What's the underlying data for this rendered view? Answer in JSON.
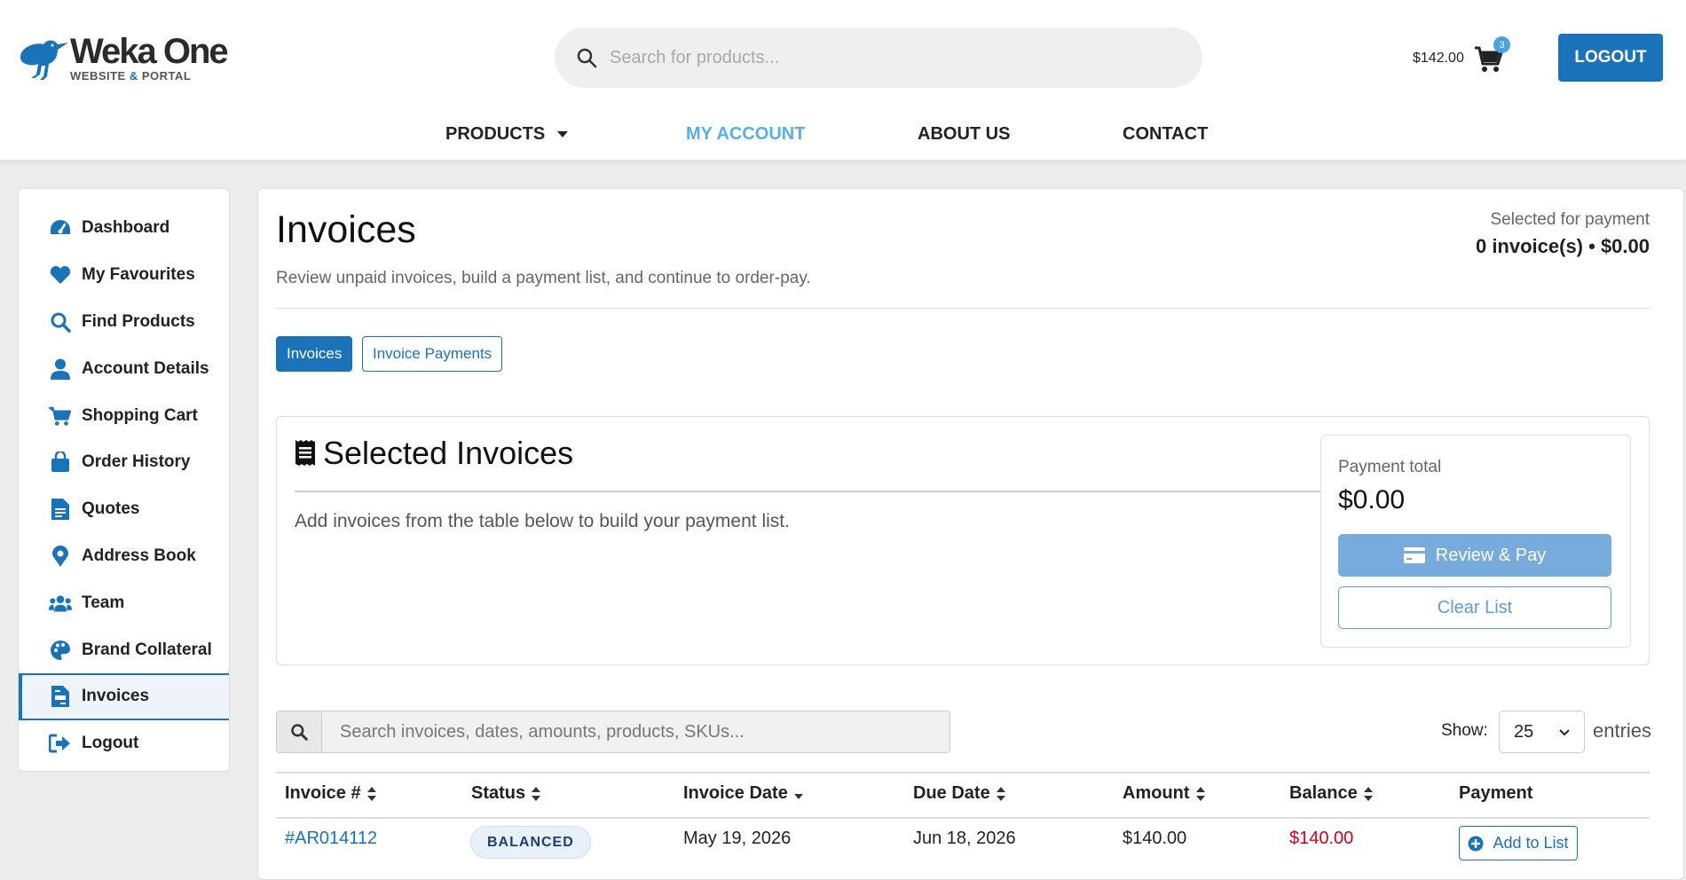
{
  "brand": {
    "name": "Weka One",
    "tagline_left": "WEBSITE",
    "tagline_amp": "&",
    "tagline_right": "PORTAL"
  },
  "search": {
    "placeholder": "Search for products..."
  },
  "cart": {
    "amount": "$142.00",
    "count": "3"
  },
  "header": {
    "logout_label": "LOGOUT"
  },
  "topnav": [
    {
      "label": "PRODUCTS",
      "active": false
    },
    {
      "label": "MY ACCOUNT",
      "active": true
    },
    {
      "label": "ABOUT US",
      "active": false
    },
    {
      "label": "CONTACT",
      "active": false
    }
  ],
  "sidebar": {
    "items": [
      {
        "label": "Dashboard",
        "icon": "dashboard-gauge-icon"
      },
      {
        "label": "My Favourites",
        "icon": "heart-icon"
      },
      {
        "label": "Find Products",
        "icon": "search-icon"
      },
      {
        "label": "Account Details",
        "icon": "user-icon"
      },
      {
        "label": "Shopping Cart",
        "icon": "cart-icon"
      },
      {
        "label": "Order History",
        "icon": "shopping-bag-icon"
      },
      {
        "label": "Quotes",
        "icon": "document-icon"
      },
      {
        "label": "Address Book",
        "icon": "map-pin-icon"
      },
      {
        "label": "Team",
        "icon": "team-icon"
      },
      {
        "label": "Brand Collateral",
        "icon": "palette-icon"
      },
      {
        "label": "Invoices",
        "icon": "invoice-icon",
        "active": true
      },
      {
        "label": "Logout",
        "icon": "logout-icon"
      }
    ]
  },
  "page": {
    "title": "Invoices",
    "subtitle": "Review unpaid invoices, build a payment list, and continue to order-pay.",
    "selected_label": "Selected for payment",
    "selected_value": "0 invoice(s) • $0.00"
  },
  "tabs": [
    {
      "label": "Invoices",
      "active": true
    },
    {
      "label": "Invoice Payments",
      "active": false
    }
  ],
  "selected_invoices": {
    "title": "Selected Invoices",
    "description": "Add invoices from the table below to build your payment list.",
    "payment_total_label": "Payment total",
    "payment_total_value": "$0.00",
    "review_pay_label": "Review & Pay",
    "clear_list_label": "Clear List"
  },
  "table_controls": {
    "search_placeholder": "Search invoices, dates, amounts, products, SKUs...",
    "show_label": "Show:",
    "show_value": "25",
    "entries_label": "entries"
  },
  "table": {
    "columns": [
      "Invoice #",
      "Status",
      "Invoice Date",
      "Due Date",
      "Amount",
      "Balance",
      "Payment"
    ],
    "rows": [
      {
        "invoice": "#AR014112",
        "status": "BALANCED",
        "invoice_date": "May 19, 2026",
        "due_date": "Jun 18, 2026",
        "amount": "$140.00",
        "balance": "$140.00",
        "action": "Add to List"
      }
    ]
  },
  "colors": {
    "brand_blue": "#1a73b8",
    "active_nav": "#5aaee0",
    "balance_red": "#d0021b"
  }
}
